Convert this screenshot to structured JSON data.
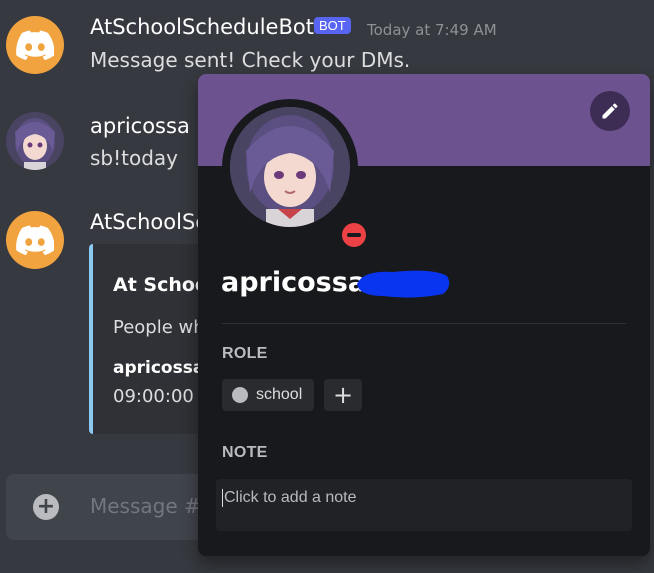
{
  "messages": [
    {
      "author": "AtSchoolScheduleBot",
      "badge": "BOT",
      "timestamp": "Today at 7:49 AM",
      "content": "Message sent! Check your DMs."
    },
    {
      "author": "apricossa",
      "content": "sb!today"
    },
    {
      "author": "AtSchoolSc",
      "embed": {
        "title": "At Schoo",
        "description": "People wh",
        "field_name": "apricossa",
        "field_value": "09:00:00"
      }
    }
  ],
  "composer": {
    "placeholder": "Message #"
  },
  "profile": {
    "username": "apricossa",
    "status": "dnd",
    "role_label": "ROLE",
    "roles": [
      {
        "name": "school",
        "color": "#b9bbbe"
      }
    ],
    "add_role": "+",
    "note_label": "NOTE",
    "note_placeholder": "Click to add a note",
    "banner_color": "#6d5290",
    "status_color": "#ed4245"
  },
  "icons": {
    "bot_avatar": "discord-logo-icon",
    "edit": "pencil-icon",
    "composer_add": "plus-circle-icon"
  }
}
